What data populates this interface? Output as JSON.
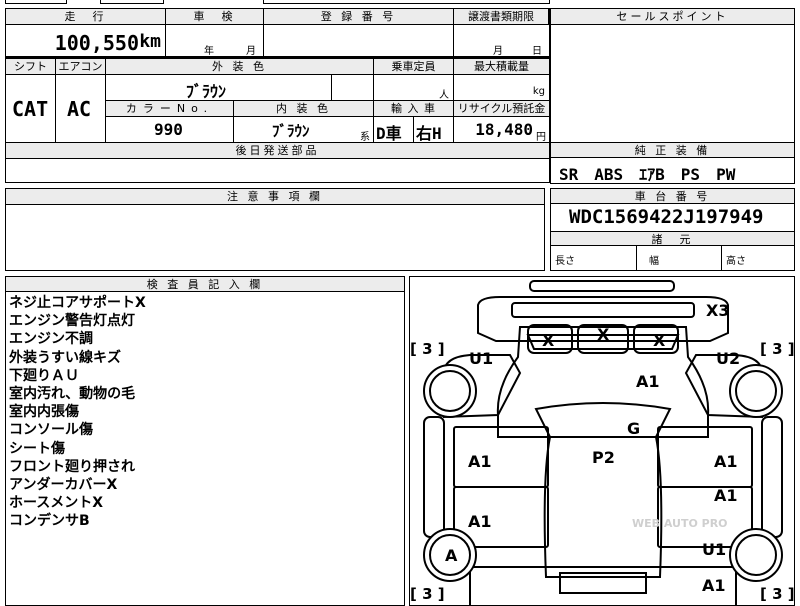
{
  "header": {
    "mileage_label": "走　行",
    "inspection_label": "車　検",
    "registration_label": "登 録 番 号",
    "transfer_docs_label": "譲渡書類期限",
    "sales_points_label": "セールスポイント",
    "mileage_value": "100,550",
    "mileage_unit": "km",
    "inspection_year_unit": "年",
    "inspection_month_unit": "月",
    "transfer_month_unit": "月",
    "transfer_day_unit": "日"
  },
  "specs": {
    "shift_label": "シフト",
    "aircon_label": "エアコン",
    "exterior_color_label": "外 装 色",
    "capacity_label": "乗車定員",
    "max_load_label": "最大積載量",
    "shift_value": "CAT",
    "aircon_value": "AC",
    "exterior_color_value": "ﾌﾞﾗｳﾝ",
    "capacity_unit": "人",
    "max_load_unit": "kg",
    "color_no_label": "カラーNo.",
    "interior_color_label": "内 装 色",
    "import_label": "輸 入 車",
    "recycle_label": "リサイクル預託金",
    "color_no_value": "990",
    "interior_color_value": "ﾌﾞﾗｳﾝ",
    "interior_color_suffix": "系",
    "import_dealer": "D車",
    "import_handle": "右H",
    "recycle_value": "18,480",
    "recycle_unit": "円",
    "later_parts_label": "後日発送部品"
  },
  "equipment": {
    "label": "純 正 装 備",
    "value": "SR　ABS　ｴｱB　PS　PW"
  },
  "cautions": {
    "label": "注 意 事 項 欄"
  },
  "chassis": {
    "label": "車 台 番 号",
    "value": "WDC1569422J197949",
    "dimensions_label": "諸　元",
    "length_label": "長さ",
    "width_label": "幅",
    "height_label": "高さ"
  },
  "inspector": {
    "label": "検 査 員 記 入 欄",
    "notes": [
      "ネジ止コアサポートX",
      "エンジン警告灯点灯",
      "エンジン不調",
      "外装うすい線キズ",
      "下廻りＡＵ",
      "室内汚れ、動物の毛",
      "室内内張傷",
      "コンソール傷",
      "シート傷",
      "フロント廻り押され",
      "アンダーカバーX",
      "ホースメントX",
      "コンデンサB"
    ]
  },
  "diagram": {
    "marks": {
      "x3": "X3",
      "x_left": "X",
      "x_mid": "X",
      "x_right": "X",
      "u1_front": "U1",
      "u2_front": "U2",
      "a1_hood": "A1",
      "g": "G",
      "p2": "P2",
      "a1_left_door_front": "A1",
      "a1_right_door_front": "A1",
      "a1_right_door_mid": "A1",
      "a1_left_door_rear": "A1",
      "a_rear_wheel": "A",
      "u1_rear": "U1",
      "a1_rear": "A1"
    },
    "tire_tread": [
      "[ 3 ]",
      "[ 3 ]",
      "[ 3 ]",
      "[ 3 ]"
    ],
    "watermark": "WEB AUTO PRO"
  }
}
